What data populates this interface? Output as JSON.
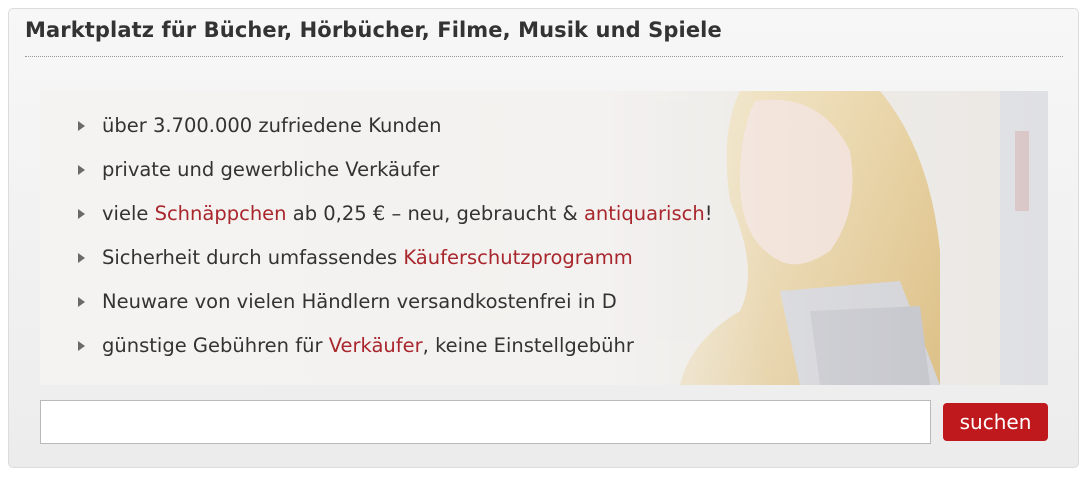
{
  "panel": {
    "title": "Marktplatz für Bücher, Hörbücher, Filme, Musik und Spiele"
  },
  "features": [
    {
      "segments": [
        {
          "text": "über 3.700.000 zufriedene Kunden",
          "link": false
        }
      ]
    },
    {
      "segments": [
        {
          "text": "private und gewerbliche Verkäufer",
          "link": false
        }
      ]
    },
    {
      "segments": [
        {
          "text": "viele ",
          "link": false
        },
        {
          "text": "Schnäppchen",
          "link": true
        },
        {
          "text": " ab 0,25 € – neu, gebraucht & ",
          "link": false
        },
        {
          "text": "antiquarisch",
          "link": true
        },
        {
          "text": "!",
          "link": false
        }
      ]
    },
    {
      "segments": [
        {
          "text": "Sicherheit durch umfassendes ",
          "link": false
        },
        {
          "text": "Käuferschutzprogramm",
          "link": true
        }
      ]
    },
    {
      "segments": [
        {
          "text": "Neuware von vielen Händlern versandkostenfrei in D",
          "link": false
        }
      ]
    },
    {
      "segments": [
        {
          "text": "günstige Gebühren für ",
          "link": false
        },
        {
          "text": "Verkäufer",
          "link": true
        },
        {
          "text": ", keine Einstellgebühr",
          "link": false
        }
      ]
    }
  ],
  "search": {
    "value": "",
    "placeholder": "",
    "button_label": "suchen"
  },
  "colors": {
    "link": "#a8262c",
    "button": "#c0191d",
    "text": "#333333"
  },
  "icons": {
    "bullet": "triangle-right-icon"
  }
}
